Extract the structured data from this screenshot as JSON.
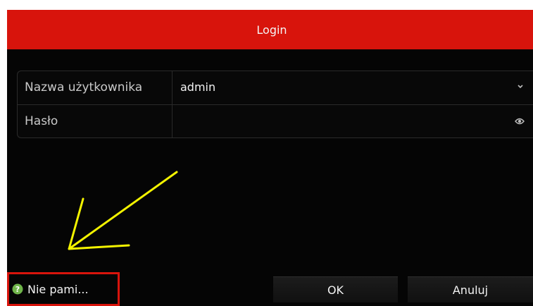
{
  "dialog": {
    "title": "Login",
    "titlebar_color": "#d8140c"
  },
  "form": {
    "username_label": "Nazwa użytkownika",
    "username_value": "admin",
    "password_label": "Hasło",
    "password_value": ""
  },
  "footer": {
    "forgot_label": "Nie pami...",
    "ok_label": "OK",
    "cancel_label": "Anuluj"
  },
  "icons": {
    "dropdown": "chevron-down-icon",
    "show_password": "eye-icon",
    "help": "help-circle-icon"
  },
  "annotation": {
    "arrow_color": "#f3f300",
    "highlight_color": "#d8140c"
  }
}
